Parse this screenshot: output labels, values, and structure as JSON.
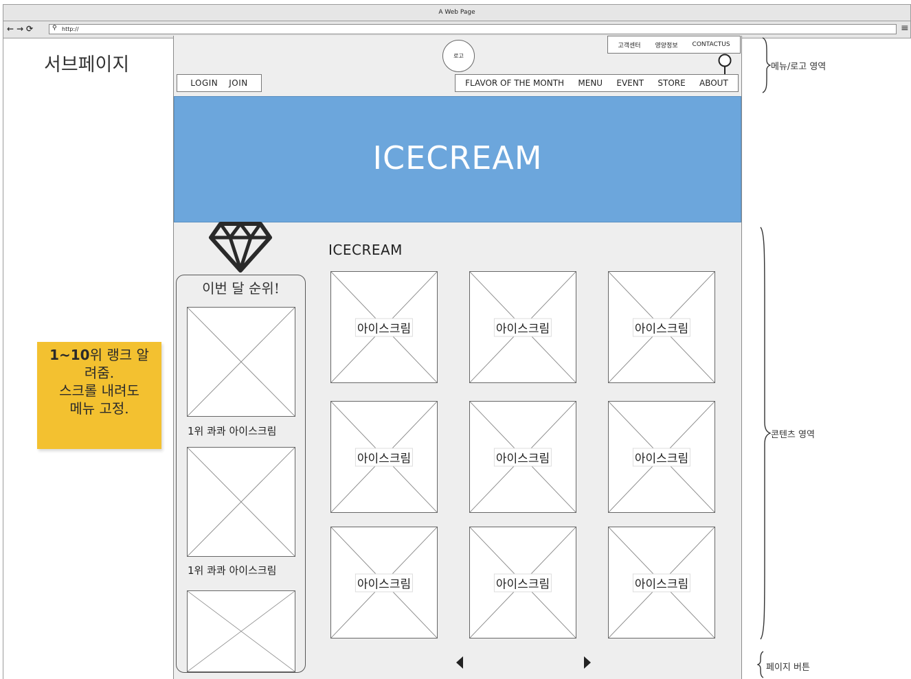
{
  "browser": {
    "window_title": "A Web Page",
    "url": "http://"
  },
  "page_label": "서브페이지",
  "sticky_note": {
    "line1_bold": "1~10",
    "line1_rest": "위 랭크 알",
    "line2": "려줌.",
    "line3": "스크롤 내려도",
    "line4": "메뉴 고정."
  },
  "header": {
    "logo": "로고",
    "utility_links": [
      "고객센터",
      "영양정보",
      "CONTACTUS"
    ],
    "login": "LOGIN",
    "join": "JOIN",
    "nav": [
      "FLAVOR OF THE MONTH",
      "MENU",
      "EVENT",
      "STORE",
      "ABOUT"
    ]
  },
  "hero": {
    "title": "ICECREAM"
  },
  "ranking": {
    "title": "이번 달 순위!",
    "items": [
      {
        "caption": "1위 콰콰 아이스크림"
      },
      {
        "caption": "1위 콰콰 아이스크림"
      },
      {
        "caption": ""
      }
    ]
  },
  "content": {
    "title": "ICECREAM",
    "products": [
      "아이스크림",
      "아이스크림",
      "아이스크림",
      "아이스크림",
      "아이스크림",
      "아이스크림",
      "아이스크림",
      "아이스크림",
      "아이스크림"
    ]
  },
  "annotations": {
    "menu_logo_area": "메뉴/로고 영역",
    "content_area": "콘텐츠 영역",
    "page_buttons": "페이지 버튼"
  },
  "colors": {
    "hero_bg": "#6ca6dc",
    "sticky_bg": "#f3c130",
    "canvas_bg": "#eeeeee"
  }
}
